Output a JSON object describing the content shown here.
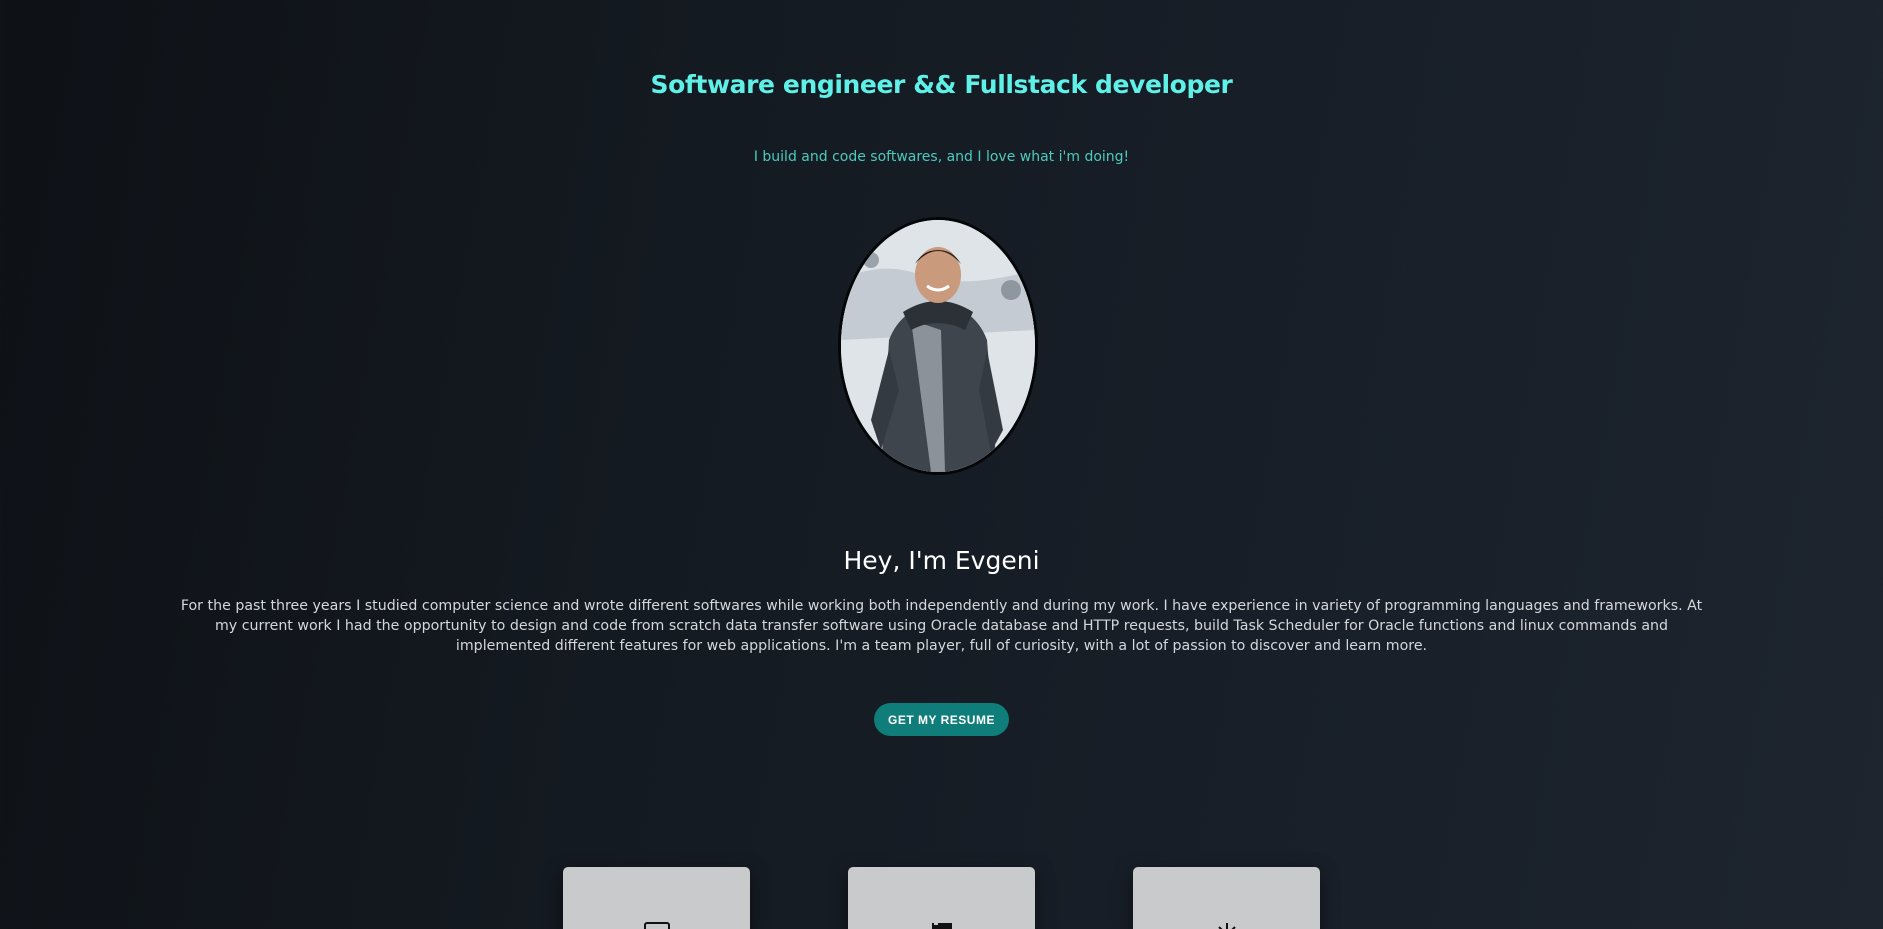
{
  "hero": {
    "title": "Software engineer && Fullstack developer",
    "subtitle": "I build and code softwares, and I love what i'm doing!"
  },
  "about": {
    "heading": "Hey, I'm Evgeni",
    "text": "For the past three years I studied computer science and wrote different softwares while working both independently and during my work. I have experience in variety of programming languages and frameworks. At my current work I had the opportunity to design and code from scratch data transfer software using Oracle database and HTTP requests, build Task Scheduler for Oracle functions and linux commands and implemented different features for web applications. I'm a team player, full of curiosity, with a lot of passion to discover and learn more.",
    "resume_button": "GET MY RESUME"
  },
  "cards": [
    {
      "icon": "laptop-icon"
    },
    {
      "icon": "code-file-icon"
    },
    {
      "icon": "sun-icon"
    }
  ],
  "colors": {
    "accent": "#5ff0e8",
    "subtitle": "#4ec9bf",
    "button": "#0f7d7a"
  }
}
